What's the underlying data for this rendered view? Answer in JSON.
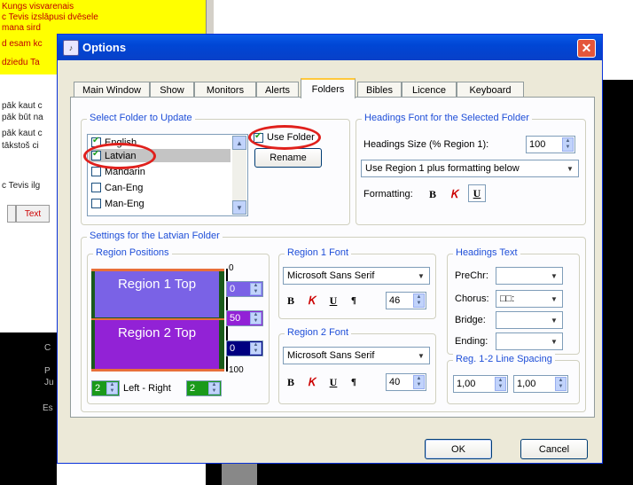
{
  "background": {
    "yellow_lines": [
      "Kungs visvarenais",
      "c Tevis izslāpusi dvēsele",
      "mana sird",
      "d esam kc",
      "dziedu Ta"
    ],
    "white_lines": [
      "pāk kaut c",
      "pāk būt na",
      "pāk kaut c",
      "tākstoš ci",
      "c Tevis ilg"
    ],
    "text_button": "Text",
    "dark_lines": [
      "C",
      "P",
      "Ju",
      "Es"
    ]
  },
  "dialog": {
    "title": "Options",
    "close_symbol": "✕",
    "tabs": [
      "Main Window",
      "Show",
      "Monitors",
      "Alerts",
      "Folders",
      "Bibles",
      "Licence",
      "Keyboard"
    ],
    "active_tab": "Folders",
    "select_folder": {
      "label": "Select Folder to Update",
      "items": [
        {
          "label": "English",
          "checked": true
        },
        {
          "label": "Latvian",
          "checked": true
        },
        {
          "label": "Mandarin",
          "checked": false
        },
        {
          "label": "Can-Eng",
          "checked": false
        },
        {
          "label": "Man-Eng",
          "checked": false
        }
      ],
      "use_folder_label": "Use Folder",
      "use_folder_checked": true,
      "rename_label": "Rename"
    },
    "headings_font": {
      "label": "Headings Font for the Selected Folder",
      "size_label": "Headings Size (% Region 1):",
      "size_value": "100",
      "mode": "Use Region 1 plus formatting below",
      "formatting_label": "Formatting:"
    },
    "latvian_settings": {
      "label": "Settings for the Latvian Folder",
      "region_positions": {
        "label": "Region Positions",
        "region1": "Region 1 Top",
        "region2": "Region 2 Top",
        "scale_top": "0",
        "scale_bottom": "100",
        "val1": "0",
        "val2": "50",
        "val3": "0",
        "left_value": "2",
        "left_right_label": "Left - Right",
        "right_value": "2"
      },
      "region1_font": {
        "label": "Region 1 Font",
        "font": "Microsoft Sans Serif",
        "size": "46"
      },
      "region2_font": {
        "label": "Region 2 Font",
        "font": "Microsoft Sans Serif",
        "size": "40"
      },
      "headings_text": {
        "label": "Headings Text",
        "prechr": "PreChr:",
        "chorus": "Chorus:",
        "chorus_value": "□□:",
        "bridge": "Bridge:",
        "ending": "Ending:"
      },
      "line_spacing": {
        "label": "Reg. 1-2 Line Spacing",
        "v1": "1,00",
        "v2": "1,00"
      }
    },
    "ok_label": "OK",
    "cancel_label": "Cancel",
    "fmt": {
      "bold": "B",
      "italic": "𝐾",
      "underline": "U",
      "para": "¶"
    }
  },
  "colors": {
    "accent_blue": "#1e4ed8",
    "annotation_red": "#e0201c",
    "region1": "#7a62e6",
    "region2": "#9222d6"
  }
}
